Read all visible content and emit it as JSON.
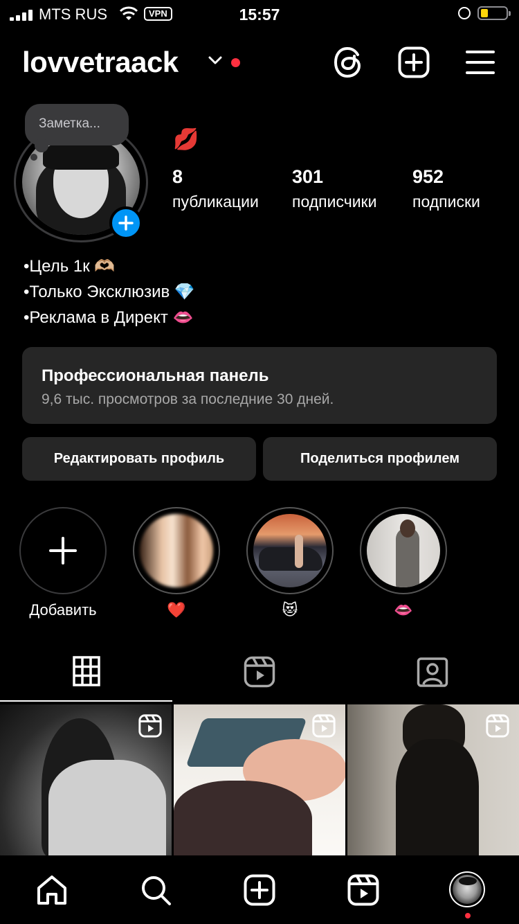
{
  "status_bar": {
    "carrier": "MTS RUS",
    "vpn": "VPN",
    "time": "15:57",
    "battery_color": "#ffd60a"
  },
  "header": {
    "username": "lovvetraack",
    "icons": [
      "chevron-down-icon",
      "threads-icon",
      "create-post-icon",
      "menu-icon"
    ],
    "notification_dot_color": "#ff3040"
  },
  "profile": {
    "note_placeholder": "Заметка...",
    "name_emoji": "💋",
    "stats": [
      {
        "value": "8",
        "label": "публикации"
      },
      {
        "value": "301",
        "label": "подписчики"
      },
      {
        "value": "952",
        "label": "подписки"
      }
    ],
    "bio": [
      "•Цель 1к 🫶🏼",
      "•Только Эксклюзив 💎",
      "•Реклама в Директ 👄"
    ]
  },
  "dashboard": {
    "title": "Профессиональная панель",
    "subtitle": "9,6 тыс. просмотров за последние 30 дней."
  },
  "buttons": {
    "edit_profile": "Редактировать профиль",
    "share_profile": "Поделиться профилем"
  },
  "highlights": [
    {
      "label": "Добавить",
      "kind": "new"
    },
    {
      "label": "❤️",
      "kind": "story"
    },
    {
      "label": "😻",
      "kind": "story"
    },
    {
      "label": "👄",
      "kind": "story"
    }
  ],
  "tabs": [
    "grid-icon",
    "reels-icon",
    "tagged-icon"
  ],
  "grid_posts": [
    {
      "type": "reel"
    },
    {
      "type": "reel"
    },
    {
      "type": "reel"
    }
  ],
  "bottom_nav": [
    "home-icon",
    "search-icon",
    "create-icon",
    "reels-icon",
    "profile-avatar"
  ],
  "colors": {
    "accent": "#0095f6",
    "surface": "#262626",
    "background": "#000000"
  }
}
